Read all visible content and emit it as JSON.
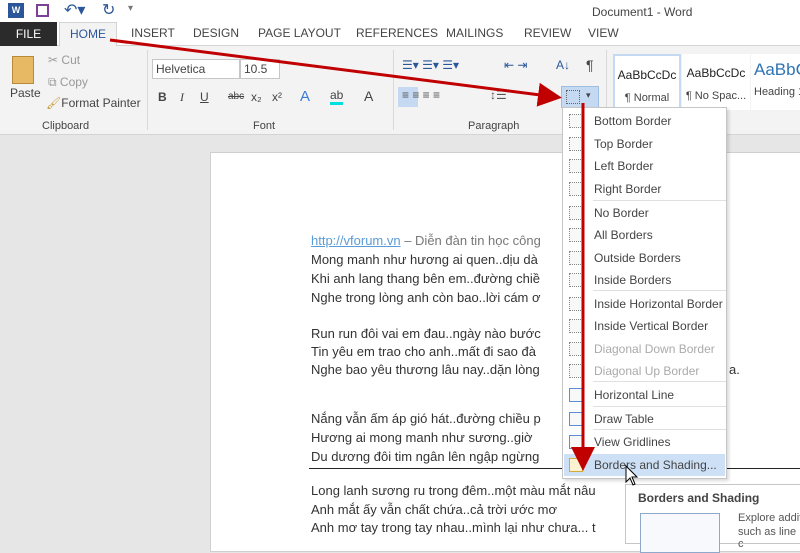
{
  "window": {
    "title": "Document1 - Word"
  },
  "quick_access": {
    "icons": [
      "word-logo-icon",
      "save-icon",
      "undo-icon",
      "redo-icon",
      "customize-icon"
    ]
  },
  "tabs": [
    "FILE",
    "HOME",
    "INSERT",
    "DESIGN",
    "PAGE LAYOUT",
    "REFERENCES",
    "MAILINGS",
    "REVIEW",
    "VIEW"
  ],
  "active_tab": "HOME",
  "clipboard": {
    "paste": "Paste",
    "cut": "Cut",
    "copy": "Copy",
    "format_painter": "Format Painter",
    "label": "Clipboard"
  },
  "font": {
    "name": "Helvetica",
    "size": "10.5",
    "label": "Font",
    "bold": "B",
    "italic": "I",
    "underline": "U",
    "strike": "abc",
    "sub": "x₂",
    "sup": "x²",
    "color": "A"
  },
  "paragraph": {
    "label": "Paragraph",
    "pilcrow": "¶"
  },
  "styles": [
    {
      "preview": "AaBbCcDc",
      "name": "¶ Normal"
    },
    {
      "preview": "AaBbCcDc",
      "name": "¶ No Spac..."
    },
    {
      "preview": "AaBbC",
      "name": "Heading 1"
    }
  ],
  "document": {
    "link": "http://vforum.vn",
    "link_suffix": " – Diễn đàn tin học công",
    "lines": [
      "Mong manh như hương ai quen..dịu dà",
      "Khi anh lang thang bên em..đường chiề",
      "Nghe trong lòng anh còn bao..lời cám ơ",
      "Run run đôi vai em đau..ngày nào bước",
      "Tin yêu em trao cho anh..mất đi sao đà",
      "Nghe bao yêu thương lâu nay..dặn lòng",
      "Nắng vẫn ấm áp gió hát..đường chiều p",
      "Hương ai mong manh như sương..giờ",
      "Du dương đôi tim ngân lên ngập ngừng",
      "Long lanh sương ru trong đêm..một màu mắt nâu",
      "Anh mắt ấy vẫn chất chứa..cả trời ước mơ",
      "Anh mơ tay trong tay nhau..mình lại như chưa... t"
    ],
    "line6_tail": "a."
  },
  "borders_menu": {
    "items": [
      "Bottom Border",
      "Top Border",
      "Left Border",
      "Right Border",
      "No Border",
      "All Borders",
      "Outside Borders",
      "Inside Borders",
      "Inside Horizontal Border",
      "Inside Vertical Border",
      "Diagonal Down Border",
      "Diagonal Up Border",
      "Horizontal Line",
      "Draw Table",
      "View Gridlines",
      "Borders and Shading..."
    ],
    "highlighted": "Borders and Shading..."
  },
  "tooltip": {
    "title": "Borders and Shading",
    "text1": "Explore addit",
    "text2": "such as line c"
  },
  "colors": {
    "accent": "#2b579a",
    "arrow": "#c00000",
    "highlight": "#cde0f5"
  }
}
